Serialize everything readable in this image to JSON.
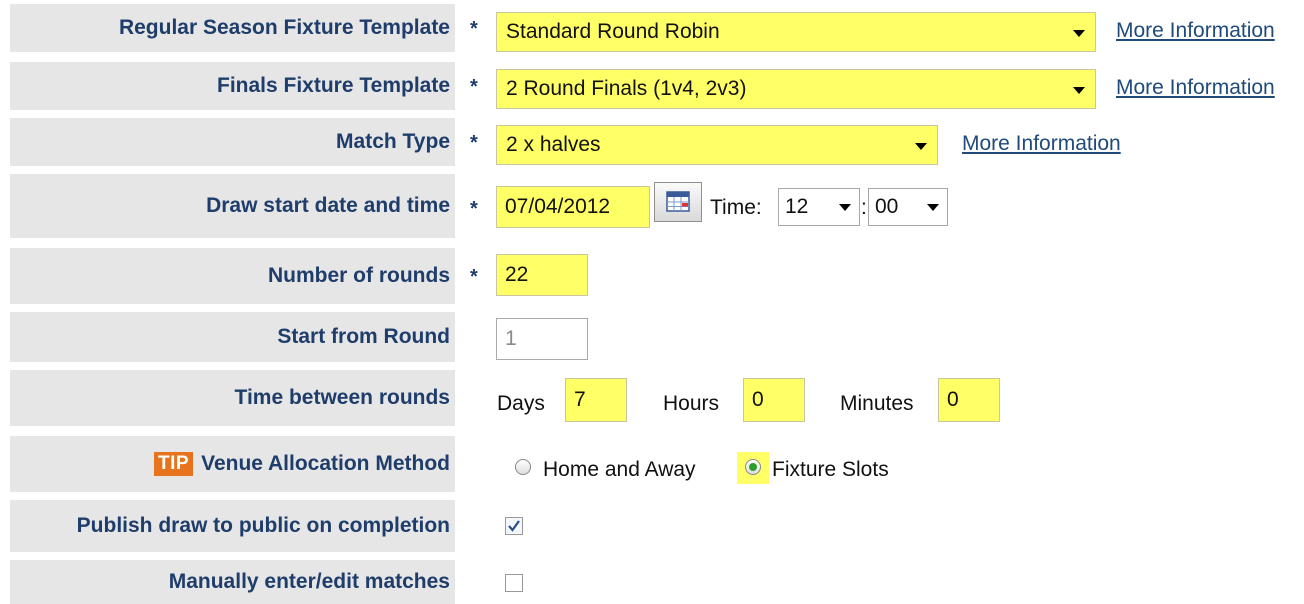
{
  "form": {
    "regular_season": {
      "label": "Regular Season Fixture Template",
      "required": "*",
      "value": "Standard Round Robin",
      "link": "More Information"
    },
    "finals": {
      "label": "Finals Fixture Template",
      "required": "*",
      "value": "2 Round Finals (1v4, 2v3)",
      "link": "More Information"
    },
    "match_type": {
      "label": "Match Type",
      "required": "*",
      "value": "2 x halves",
      "link": "More Information"
    },
    "draw_start": {
      "label": "Draw start date and time",
      "required": "*",
      "date": "07/04/2012",
      "time_label": "Time:",
      "hour": "12",
      "separator": ":",
      "minute": "00"
    },
    "rounds": {
      "label": "Number of rounds",
      "required": "*",
      "value": "22"
    },
    "start_round": {
      "label": "Start from Round",
      "value": "1"
    },
    "time_between": {
      "label": "Time between rounds",
      "days_label": "Days",
      "days": "7",
      "hours_label": "Hours",
      "hours": "0",
      "minutes_label": "Minutes",
      "minutes": "0"
    },
    "venue": {
      "tip": "TIP",
      "label": "Venue Allocation Method",
      "options": [
        "Home and Away",
        "Fixture Slots"
      ],
      "selected": "Fixture Slots"
    },
    "publish": {
      "label": "Publish draw to public on completion",
      "checked": true
    },
    "manual": {
      "label": "Manually enter/edit matches",
      "checked": false
    }
  },
  "colors": {
    "highlight": "#ffff66",
    "label_bg": "#e6e6e6",
    "label_text": "#1f3d6b",
    "link": "#1f4a7a",
    "tip_badge": "#e7741d"
  }
}
